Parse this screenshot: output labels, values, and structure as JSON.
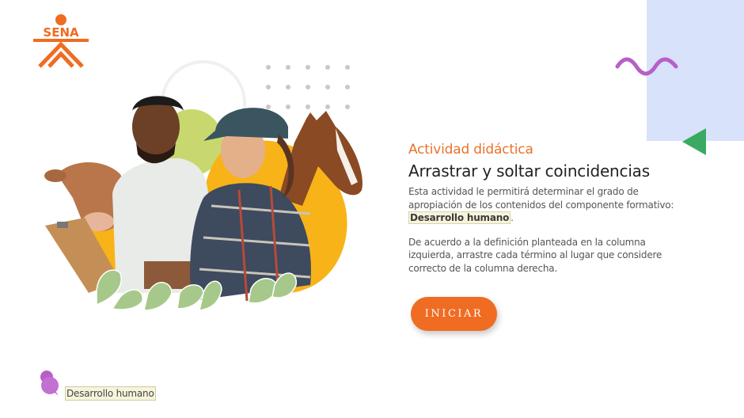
{
  "logo": {
    "text": "SENA",
    "color": "#ef6c22"
  },
  "content": {
    "label": "Actividad didáctica",
    "title": "Arrastrar y soltar coincidencias",
    "description_prefix": "Esta actividad le permitirá determinar el grado de apropiación de los contenidos del componente formativo:",
    "description_highlight": "Desarrollo humano",
    "description_suffix": ".",
    "instructions": "De acuerdo a la definición planteada en la columna izquierda, arrastre cada término al lugar que considere correcto de la columna derecha."
  },
  "start_button": {
    "label": "INICIAR",
    "color": "#ef6c22"
  },
  "footer": {
    "label": "Desarrollo humano",
    "icon": "puzzle-icon"
  },
  "colors": {
    "accent_orange": "#ef6c22",
    "lavender_panel": "#d8e2fb",
    "purple_wave": "#b85fc7",
    "green_triangle": "#3aaa63"
  }
}
